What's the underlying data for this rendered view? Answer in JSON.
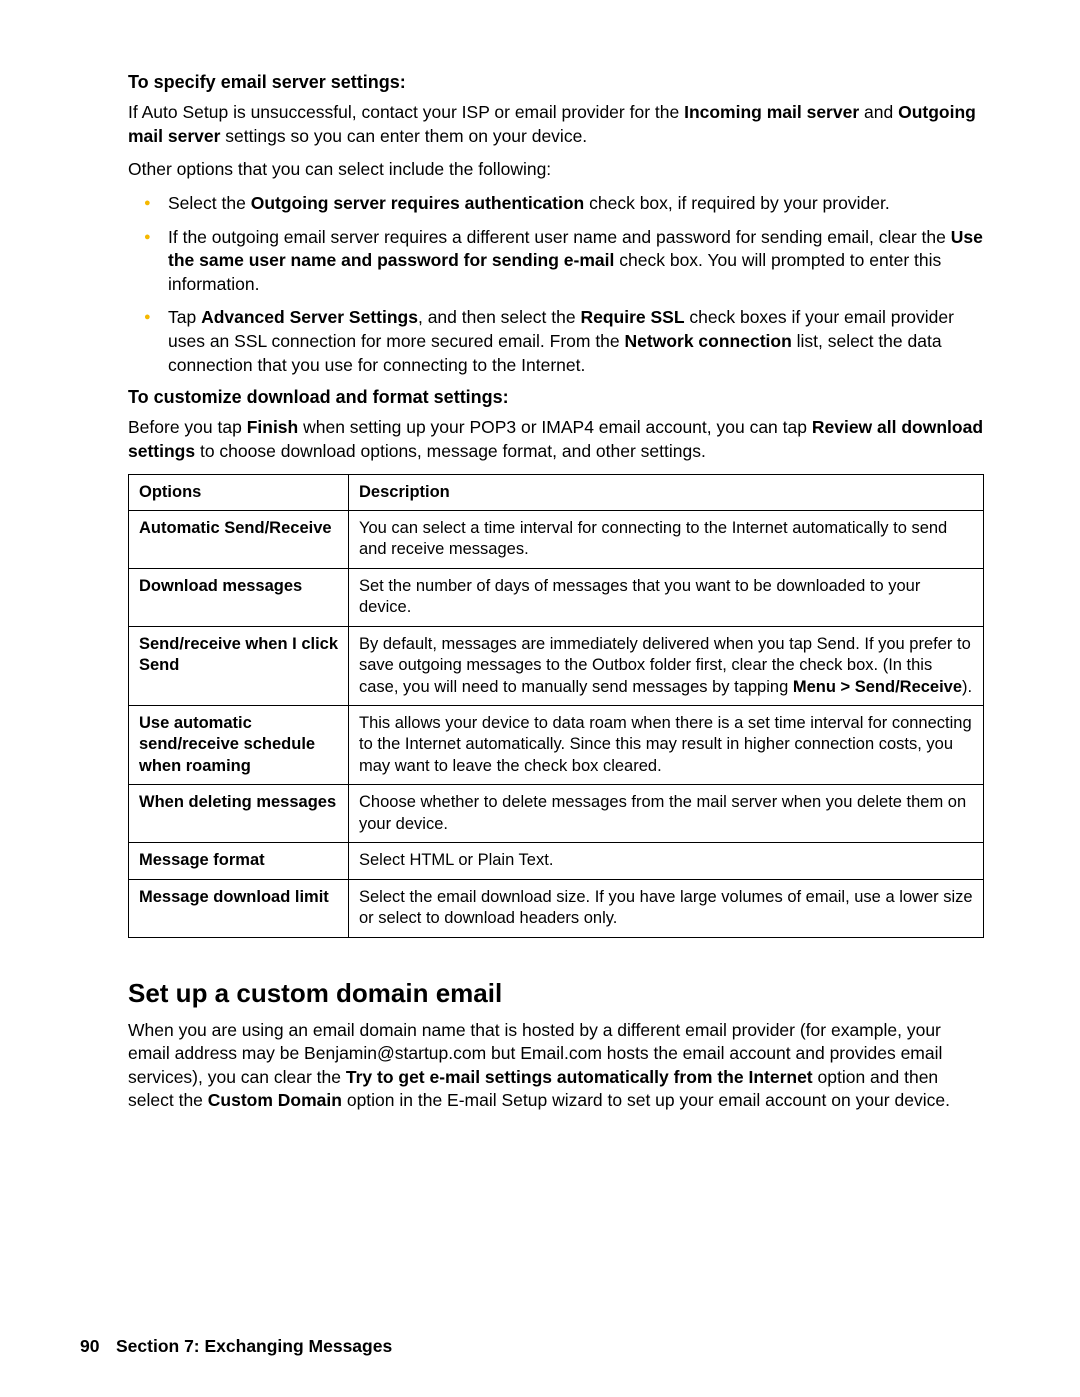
{
  "section1": {
    "heading": "To specify email server settings:",
    "p1_a": "If Auto Setup is unsuccessful, contact your ISP or email provider for the ",
    "p1_b1": "Incoming mail server",
    "p1_c": " and ",
    "p1_b2": "Outgoing mail server",
    "p1_d": " settings so you can enter them on your device.",
    "p2": "Other options that you can select include the following:",
    "li1_a": "Select the ",
    "li1_b": "Outgoing server requires authentication",
    "li1_c": " check box, if required by your provider.",
    "li2_a": "If the outgoing email server requires a different user name and password for sending email, clear the ",
    "li2_b": "Use the same user name and password for sending e-mail",
    "li2_c": " check box. You will prompted to enter this information.",
    "li3_a": "Tap ",
    "li3_b1": "Advanced Server Settings",
    "li3_c": ", and then select the ",
    "li3_b2": "Require SSL",
    "li3_d": " check boxes if your email provider uses an SSL connection for more secured email. From the ",
    "li3_b3": "Network connection",
    "li3_e": " list, select the data connection that you use for connecting to the Internet."
  },
  "section2": {
    "heading": "To customize download and format settings:",
    "p1_a": "Before you tap ",
    "p1_b1": "Finish",
    "p1_c": " when setting up your POP3 or IMAP4 email account, you can tap ",
    "p1_b2": "Review all download settings",
    "p1_d": " to choose download options, message format, and other settings."
  },
  "table": {
    "h1": "Options",
    "h2": "Description",
    "r1o": "Automatic Send/Receive",
    "r1d": "You can select a time interval for connecting to the Internet automatically to send and receive messages.",
    "r2o": "Download messages",
    "r2d": "Set the number of days of messages that you want to be downloaded to your device.",
    "r3o": "Send/receive when I click Send",
    "r3d_a": "By default, messages are immediately delivered when you tap Send. If you prefer to save outgoing messages to the Outbox folder first, clear the check box. (In this case, you will need to manually send messages by tapping ",
    "r3d_b": "Menu > Send/Receive",
    "r3d_c": ").",
    "r4o": "Use automatic send/receive schedule when roaming",
    "r4d": "This allows your device to data roam when there is a set time interval for connecting to the Internet automatically. Since this may result in higher connection costs, you may want to leave the check box cleared.",
    "r5o": "When deleting messages",
    "r5d": "Choose whether to delete messages from the mail server when you delete them on your device.",
    "r6o": "Message format",
    "r6d": "Select HTML or Plain Text.",
    "r7o": "Message download limit",
    "r7d": "Select the email download size. If you have large volumes of email, use a lower size or select to download headers only."
  },
  "section3": {
    "heading": "Set up a custom domain email",
    "p_a": "When you are using an email domain name that is hosted by a different email provider (for example, your email address may be Benjamin@startup.com but Email.com hosts the email account and provides email services), you can clear the ",
    "p_b1": "Try to get e-mail settings automatically from the Internet",
    "p_c": " option and then select the ",
    "p_b2": "Custom Domain",
    "p_d": " option in the E-mail Setup wizard to set up your email account on your device."
  },
  "footer": {
    "page": "90",
    "section": "Section 7: Exchanging Messages"
  }
}
